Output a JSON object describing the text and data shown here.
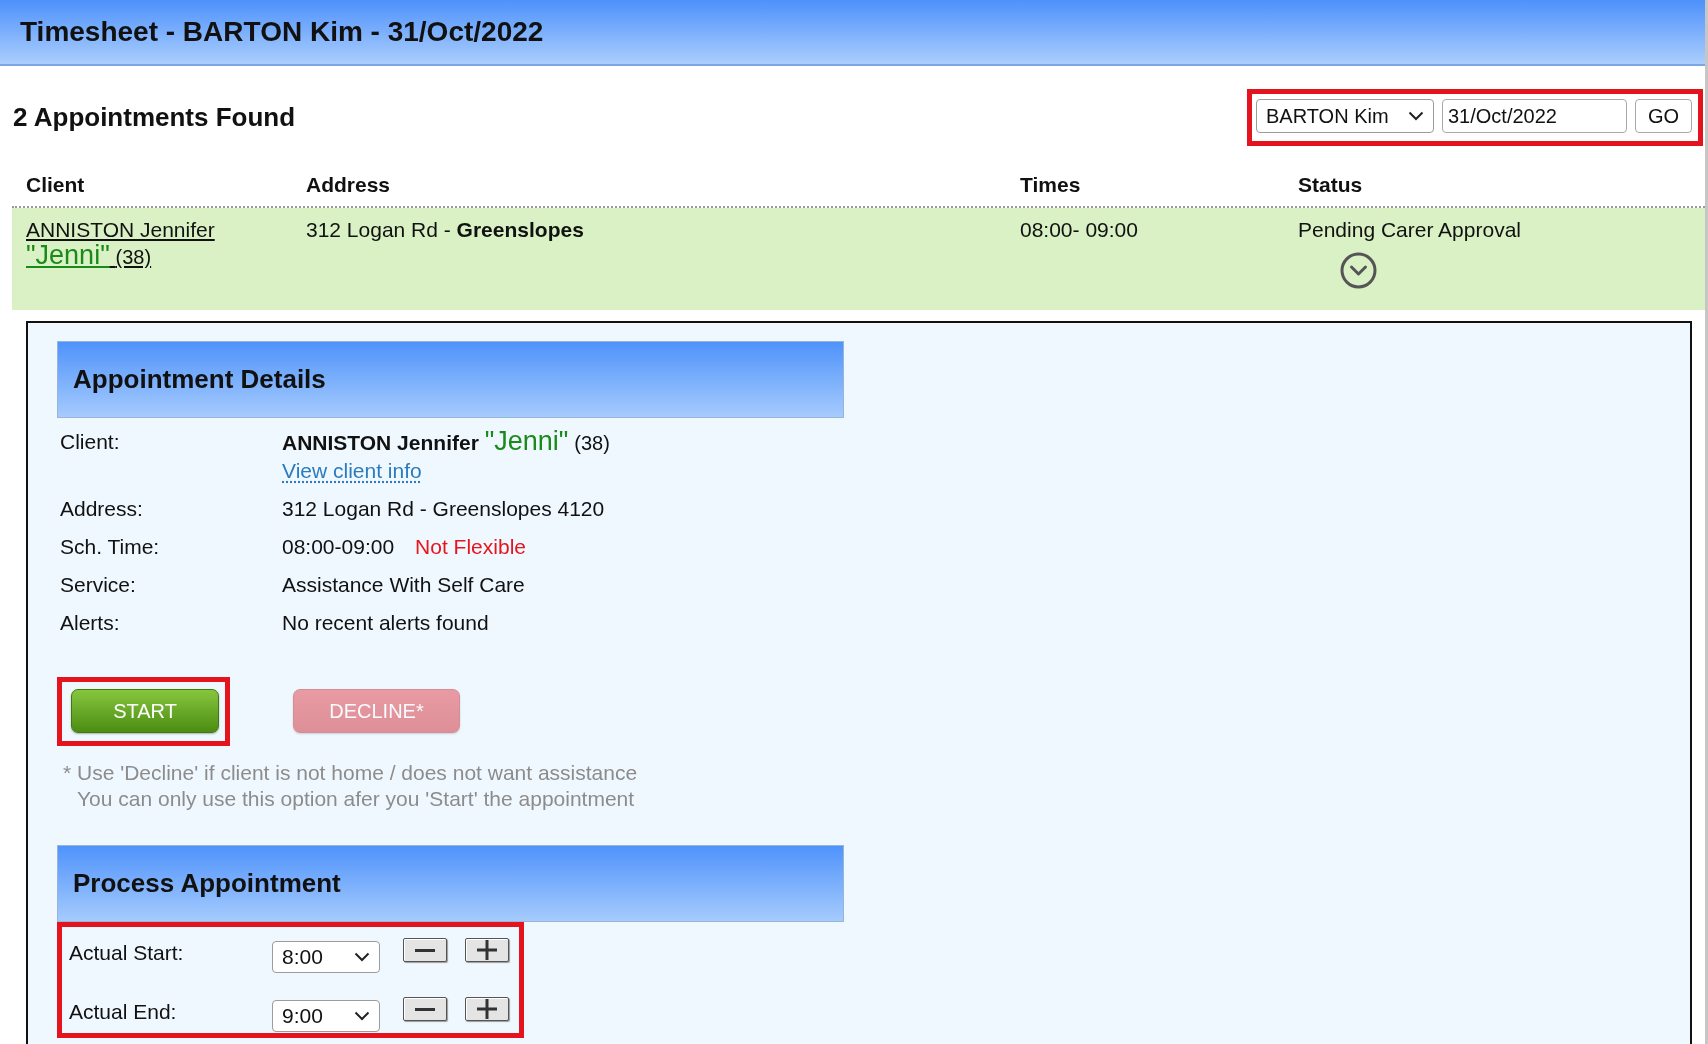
{
  "header": {
    "title": "Timesheet - BARTON Kim - 31/Oct/2022"
  },
  "summary": {
    "count_text": "2 Appointments Found"
  },
  "filter": {
    "highlighted": true,
    "carer": "BARTON Kim",
    "date": "31/Oct/2022",
    "go_button": "GO"
  },
  "table": {
    "columns": [
      "Client",
      "Address",
      "Times",
      "Status"
    ],
    "rows": [
      {
        "client": {
          "name": "ANNISTON Jennifer",
          "nickname": "\"Jenni\"",
          "age": "(38)"
        },
        "address": "312 Logan Rd - **Greenslopes**",
        "times": "08:00- 09:00",
        "status": "Pending Carer Approval",
        "expanded": true
      }
    ]
  },
  "details": {
    "title": "Appointment Details",
    "fields": [
      {
        "kind": "client",
        "label": "Client:",
        "name": "ANNISTON Jennifer",
        "nickname": "\"Jenni\"",
        "age": "(38)",
        "link": "View client info"
      },
      {
        "kind": "text",
        "label": "Address:",
        "value": "312 Logan Rd - Greenslopes 4120"
      },
      {
        "kind": "time",
        "label": "Sch. Time:",
        "value": "08:00-09:00",
        "note": "Not Flexible"
      },
      {
        "kind": "text",
        "label": "Service:",
        "value": "Assistance With Self Care"
      },
      {
        "kind": "text",
        "label": "Alerts:",
        "value": "No recent alerts found"
      }
    ]
  },
  "actions": [
    {
      "kind": "start",
      "label": "START",
      "disabled": false,
      "highlighted": true
    },
    {
      "kind": "decline",
      "label": "DECLINE*",
      "disabled": true,
      "highlighted": false
    }
  ],
  "footnote": [
    "* Use 'Decline' if client is not home / does not want assistance",
    "You can only use this option afer you 'Start' the appointment"
  ],
  "process": {
    "title": "Process Appointment",
    "highlighted": true,
    "times": [
      {
        "label": "Actual Start:",
        "value": "8:00"
      },
      {
        "label": "Actual End:",
        "value": "9:00"
      }
    ]
  }
}
